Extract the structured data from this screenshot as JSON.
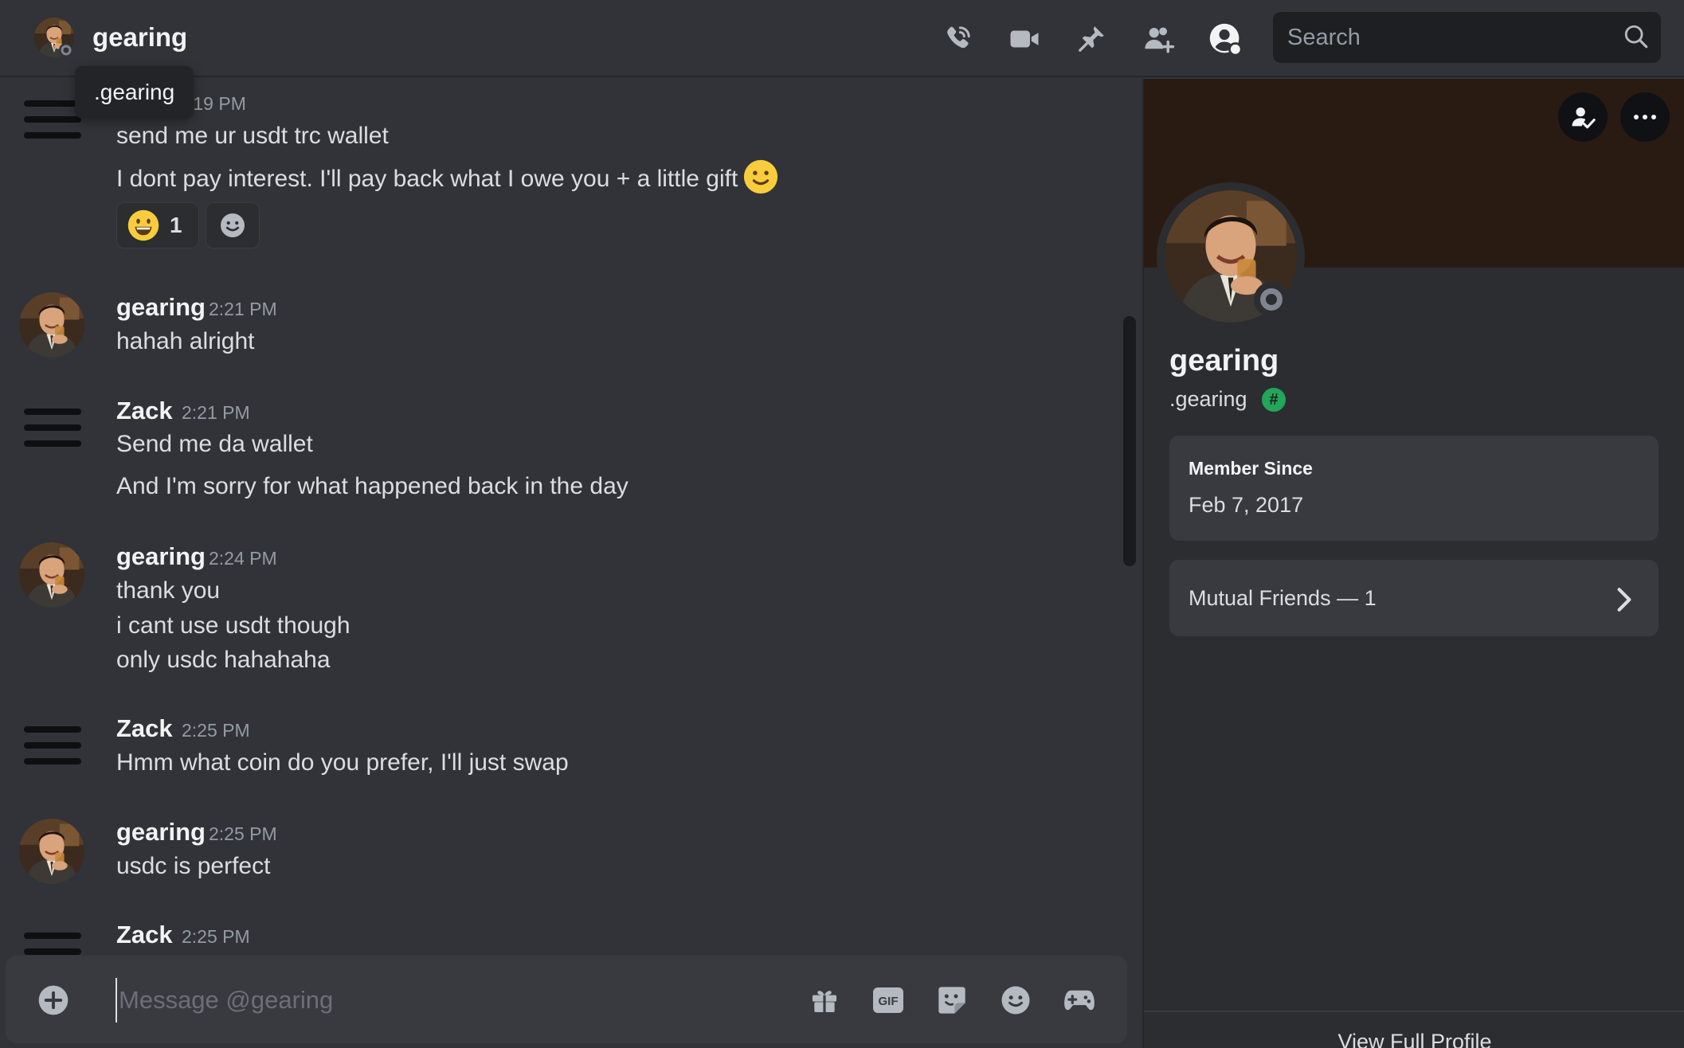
{
  "header": {
    "name": "gearing",
    "tooltip": ".gearing",
    "search_placeholder": "Search"
  },
  "icons": {
    "call": "voice-call-icon",
    "video": "video-call-icon",
    "pin": "pin-icon",
    "add_friend": "add-friends-to-dm-icon",
    "profile": "user-profile-icon",
    "search": "search-icon"
  },
  "messages": {
    "m0": {
      "time_partial": ":19 PM",
      "lines": [
        "send me ur usdt trc wallet",
        "I dont pay interest. I'll pay back what I owe you + a little gift"
      ],
      "reaction_count": "1"
    },
    "m1": {
      "author": "gearing",
      "time": "2:21 PM",
      "lines": [
        "hahah alright"
      ]
    },
    "m2": {
      "author": "Zack",
      "time": "2:21 PM",
      "lines": [
        "Send me da wallet",
        "And I'm sorry for what happened back in the day"
      ]
    },
    "m3": {
      "author": "gearing",
      "time": "2:24 PM",
      "lines": [
        "thank you",
        "i cant use usdt though",
        "only usdc hahahaha"
      ]
    },
    "m4": {
      "author": "Zack",
      "time": "2:25 PM",
      "lines": [
        "Hmm what coin do you prefer, I'll just swap"
      ]
    },
    "m5": {
      "author": "gearing",
      "time": "2:25 PM",
      "lines": [
        "usdc is perfect"
      ]
    },
    "m6": {
      "author": "Zack",
      "time": "2:25 PM"
    }
  },
  "composer": {
    "placeholder": "Message @gearing",
    "gif_label": "GIF"
  },
  "profile": {
    "display_name": "gearing",
    "username": ".gearing",
    "badge": "#",
    "member_since_label": "Member Since",
    "member_since_value": "Feb 7, 2017",
    "mutual_friends": "Mutual Friends — 1",
    "view_full": "View Full Profile"
  },
  "colors": {
    "background": "#313338",
    "panel": "#2b2d31",
    "card": "#383a40",
    "banner": "#2a1b12",
    "online_badge": "#23a55a",
    "offline_status": "#80848e"
  }
}
